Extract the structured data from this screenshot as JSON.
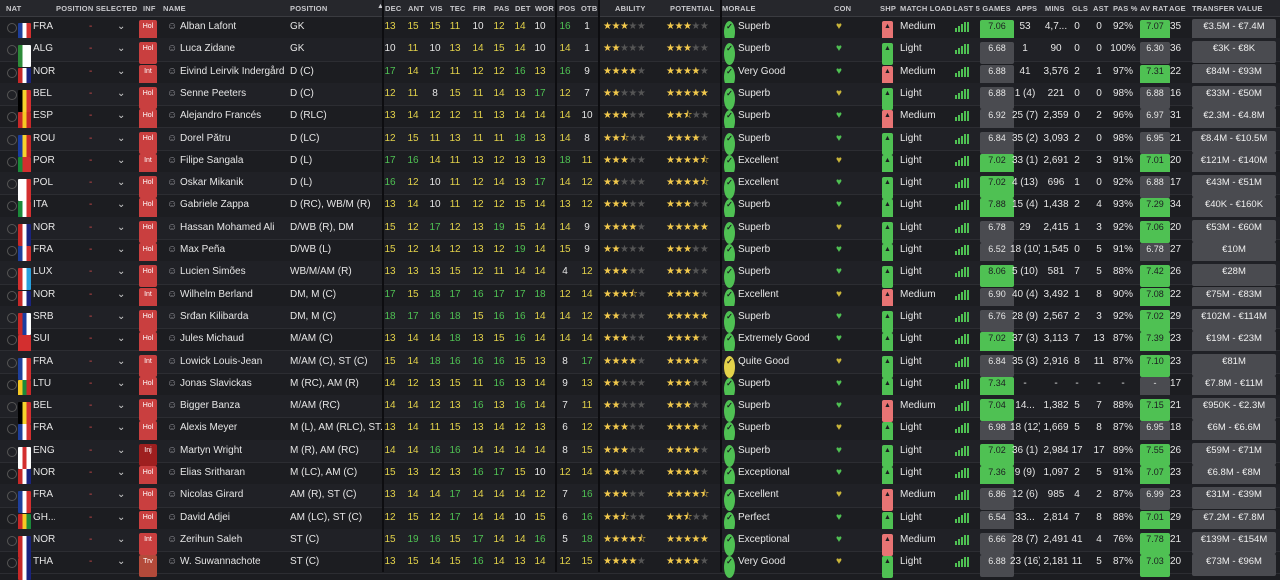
{
  "headers": [
    "NAT",
    "POSITION SELECTED",
    "INF",
    "NAME",
    "POSITION",
    "DEC",
    "ANT",
    "VIS",
    "TEC",
    "FIR",
    "PAS",
    "DET",
    "WOR",
    "POS",
    "OTB",
    "ABILITY",
    "POTENTIAL",
    "MORALE",
    "CON",
    "SHP",
    "MATCH LOAD",
    "LAST 5 GAMES",
    "APPS",
    "MINS",
    "GLS",
    "AST",
    "PAS %",
    "AV RAT",
    "AGE",
    "TRANSFER VALUE"
  ],
  "sort_icon": "sort-desc-icon",
  "colors": {
    "green": "#4fc153",
    "yellow": "#e3d24a",
    "white": "#e6e6e6",
    "star": "#f2c94c"
  },
  "players": [
    {
      "nat": "FRA",
      "inf": "Hol",
      "name": "Alban Lafont",
      "pos": "GK",
      "attrs": [
        "13",
        "15",
        "15",
        "11",
        "10",
        "12",
        "14",
        "10"
      ],
      "posv": "16",
      "otb": "1",
      "ab": 3,
      "pot": 3,
      "morale": "Superb",
      "ml": "Medium",
      "l5": "7.06",
      "apps": "53",
      "mins": "4,7...",
      "gls": "0",
      "ast": "0",
      "pas": "92%",
      "avr": "7.07",
      "age": "35",
      "tv": "€3.5M - €7.4M"
    },
    {
      "nat": "ALG",
      "inf": "Hol",
      "name": "Luca Zidane",
      "pos": "GK",
      "attrs": [
        "10",
        "11",
        "10",
        "13",
        "14",
        "15",
        "14",
        "10"
      ],
      "posv": "14",
      "otb": "1",
      "ab": 2,
      "pot": 3,
      "morale": "Superb",
      "ml": "Light",
      "l5": "6.68",
      "apps": "1",
      "mins": "90",
      "gls": "0",
      "ast": "0",
      "pas": "100%",
      "avr": "6.30",
      "age": "36",
      "tv": "€3K - €8K"
    },
    {
      "nat": "NOR",
      "inf": "Int",
      "name": "Eivind Leirvik Indergård",
      "pos": "D (C)",
      "attrs": [
        "17",
        "14",
        "17",
        "11",
        "12",
        "12",
        "16",
        "13"
      ],
      "posv": "16",
      "otb": "9",
      "ab": 4,
      "pot": 4,
      "morale": "Very Good",
      "ml": "Medium",
      "l5": "6.88",
      "apps": "41",
      "mins": "3,576",
      "gls": "2",
      "ast": "1",
      "pas": "97%",
      "avr": "7.31",
      "age": "22",
      "tv": "€84M - €93M"
    },
    {
      "nat": "BEL",
      "inf": "Hol",
      "name": "Senne Peeters",
      "pos": "D (C)",
      "attrs": [
        "12",
        "11",
        "8",
        "15",
        "11",
        "14",
        "13",
        "17"
      ],
      "posv": "12",
      "otb": "7",
      "ab": 2,
      "pot": 5,
      "morale": "Superb",
      "ml": "Light",
      "l5": "6.88",
      "apps": "1 (4)",
      "mins": "221",
      "gls": "0",
      "ast": "0",
      "pas": "98%",
      "avr": "6.88",
      "age": "16",
      "tv": "€33M - €50M"
    },
    {
      "nat": "ESP",
      "inf": "Hol",
      "name": "Alejandro Francés",
      "pos": "D (RLC)",
      "attrs": [
        "13",
        "14",
        "12",
        "12",
        "11",
        "13",
        "14",
        "14"
      ],
      "posv": "14",
      "otb": "10",
      "ab": 3,
      "pot": 2.5,
      "morale": "Superb",
      "ml": "Medium",
      "l5": "6.92",
      "apps": "25 (7)",
      "mins": "2,359",
      "gls": "0",
      "ast": "2",
      "pas": "96%",
      "avr": "6.97",
      "age": "31",
      "tv": "€2.3M - €4.8M"
    },
    {
      "nat": "ROU",
      "inf": "Hol",
      "name": "Dorel Pătru",
      "pos": "D (LC)",
      "attrs": [
        "12",
        "15",
        "11",
        "13",
        "11",
        "11",
        "18",
        "13"
      ],
      "posv": "14",
      "otb": "8",
      "ab": 2.5,
      "pot": 4,
      "morale": "Superb",
      "ml": "Light",
      "l5": "6.84",
      "apps": "35 (2)",
      "mins": "3,093",
      "gls": "2",
      "ast": "0",
      "pas": "98%",
      "avr": "6.95",
      "age": "21",
      "tv": "€8.4M - €10.5M"
    },
    {
      "nat": "POR",
      "inf": "Int",
      "name": "Filipe Sangala",
      "pos": "D (L)",
      "attrs": [
        "17",
        "16",
        "14",
        "11",
        "13",
        "12",
        "13",
        "13"
      ],
      "posv": "18",
      "otb": "11",
      "ab": 3,
      "pot": 4.5,
      "morale": "Excellent",
      "ml": "Light",
      "l5": "7.02",
      "apps": "33 (1)",
      "mins": "2,691",
      "gls": "2",
      "ast": "3",
      "pas": "91%",
      "avr": "7.01",
      "age": "20",
      "tv": "€121M - €140M"
    },
    {
      "nat": "POL",
      "inf": "Hol",
      "name": "Oskar Mikanik",
      "pos": "D (L)",
      "attrs": [
        "16",
        "12",
        "10",
        "11",
        "12",
        "14",
        "13",
        "17"
      ],
      "posv": "14",
      "otb": "12",
      "ab": 2,
      "pot": 4.5,
      "morale": "Excellent",
      "ml": "Light",
      "l5": "7.02",
      "apps": "4 (13)",
      "mins": "696",
      "gls": "1",
      "ast": "0",
      "pas": "92%",
      "avr": "6.88",
      "age": "17",
      "tv": "€43M - €51M"
    },
    {
      "nat": "ITA",
      "inf": "Hol",
      "name": "Gabriele Zappa",
      "pos": "D (RC), WB/M (R)",
      "attrs": [
        "13",
        "14",
        "10",
        "11",
        "12",
        "12",
        "15",
        "14"
      ],
      "posv": "13",
      "otb": "12",
      "ab": 3,
      "pot": 3,
      "morale": "Superb",
      "ml": "Light",
      "l5": "7.88",
      "apps": "15 (4)",
      "mins": "1,438",
      "gls": "2",
      "ast": "4",
      "pas": "93%",
      "avr": "7.29",
      "age": "34",
      "tv": "€40K - €160K"
    },
    {
      "nat": "NOR",
      "inf": "Hol",
      "name": "Hassan Mohamed Ali",
      "pos": "D/WB (R), DM",
      "attrs": [
        "15",
        "12",
        "17",
        "12",
        "13",
        "19",
        "15",
        "14"
      ],
      "posv": "14",
      "otb": "9",
      "ab": 4,
      "pot": 5,
      "morale": "Superb",
      "ml": "Light",
      "l5": "6.78",
      "apps": "29",
      "mins": "2,415",
      "gls": "1",
      "ast": "3",
      "pas": "92%",
      "avr": "7.06",
      "age": "20",
      "tv": "€53M - €60M"
    },
    {
      "nat": "FRA",
      "inf": "Hol",
      "name": "Max Peña",
      "pos": "D/WB (L)",
      "attrs": [
        "15",
        "12",
        "14",
        "12",
        "13",
        "12",
        "19",
        "14"
      ],
      "posv": "15",
      "otb": "9",
      "ab": 2,
      "pot": 3,
      "morale": "Superb",
      "ml": "Light",
      "l5": "6.52",
      "apps": "18 (10)",
      "mins": "1,545",
      "gls": "0",
      "ast": "5",
      "pas": "91%",
      "avr": "6.78",
      "age": "27",
      "tv": "€10M"
    },
    {
      "nat": "LUX",
      "inf": "Hol",
      "name": "Lucien Simões",
      "pos": "WB/M/AM (R)",
      "attrs": [
        "13",
        "13",
        "13",
        "15",
        "12",
        "11",
        "14",
        "14"
      ],
      "posv": "4",
      "otb": "12",
      "ab": 3,
      "pot": 3,
      "morale": "Superb",
      "ml": "Light",
      "l5": "8.06",
      "apps": "5 (10)",
      "mins": "581",
      "gls": "7",
      "ast": "5",
      "pas": "88%",
      "avr": "7.42",
      "age": "26",
      "tv": "€28M"
    },
    {
      "nat": "NOR",
      "inf": "Int",
      "name": "Wilhelm Berland",
      "pos": "DM, M (C)",
      "attrs": [
        "17",
        "15",
        "18",
        "17",
        "16",
        "17",
        "17",
        "18"
      ],
      "posv": "12",
      "otb": "14",
      "ab": 3.5,
      "pot": 4,
      "morale": "Excellent",
      "ml": "Medium",
      "l5": "6.90",
      "apps": "40 (4)",
      "mins": "3,492",
      "gls": "1",
      "ast": "8",
      "pas": "90%",
      "avr": "7.08",
      "age": "22",
      "tv": "€75M - €83M"
    },
    {
      "nat": "SRB",
      "inf": "Hol",
      "name": "Srđan Kilibarda",
      "pos": "DM, M (C)",
      "attrs": [
        "18",
        "17",
        "16",
        "18",
        "15",
        "16",
        "16",
        "14"
      ],
      "posv": "14",
      "otb": "12",
      "ab": 2,
      "pot": 5,
      "morale": "Superb",
      "ml": "Light",
      "l5": "6.76",
      "apps": "28 (9)",
      "mins": "2,567",
      "gls": "2",
      "ast": "3",
      "pas": "92%",
      "avr": "7.02",
      "age": "29",
      "tv": "€102M - €114M"
    },
    {
      "nat": "SUI",
      "inf": "Hol",
      "name": "Jules Michaud",
      "pos": "M/AM (C)",
      "attrs": [
        "13",
        "14",
        "14",
        "18",
        "13",
        "15",
        "16",
        "14"
      ],
      "posv": "14",
      "otb": "14",
      "ab": 3,
      "pot": 4,
      "morale": "Extremely Good",
      "ml": "Light",
      "l5": "7.02",
      "apps": "37 (3)",
      "mins": "3,113",
      "gls": "7",
      "ast": "13",
      "pas": "87%",
      "avr": "7.39",
      "age": "23",
      "tv": "€19M - €23M"
    },
    {
      "nat": "FRA",
      "inf": "Int",
      "name": "Lowick Louis-Jean",
      "pos": "M/AM (C), ST (C)",
      "attrs": [
        "15",
        "14",
        "18",
        "16",
        "16",
        "16",
        "15",
        "13"
      ],
      "posv": "8",
      "otb": "17",
      "ab": 4,
      "pot": 4,
      "morale": "Quite Good",
      "ml": "Light",
      "l5": "6.84",
      "apps": "35 (3)",
      "mins": "2,916",
      "gls": "8",
      "ast": "11",
      "pas": "87%",
      "avr": "7.10",
      "age": "23",
      "tv": "€81M"
    },
    {
      "nat": "LTU",
      "inf": "Hol",
      "name": "Jonas Slavickas",
      "pos": "M (RC), AM (R)",
      "attrs": [
        "14",
        "12",
        "13",
        "15",
        "11",
        "16",
        "13",
        "14"
      ],
      "posv": "9",
      "otb": "13",
      "ab": 2,
      "pot": 3,
      "morale": "Superb",
      "ml": "Light",
      "l5": "7.34",
      "apps": "-",
      "mins": "-",
      "gls": "-",
      "ast": "-",
      "pas": "-",
      "avr": "-",
      "age": "17",
      "tv": "€7.8M - €11M"
    },
    {
      "nat": "BEL",
      "inf": "Hol",
      "name": "Bigger Banza",
      "pos": "M/AM (RC)",
      "attrs": [
        "14",
        "14",
        "12",
        "13",
        "16",
        "13",
        "16",
        "14"
      ],
      "posv": "7",
      "otb": "11",
      "ab": 2,
      "pot": 3,
      "morale": "Superb",
      "ml": "Medium",
      "l5": "7.04",
      "apps": "14...",
      "mins": "1,382",
      "gls": "5",
      "ast": "7",
      "pas": "88%",
      "avr": "7.15",
      "age": "21",
      "tv": "€950K - €2.3M"
    },
    {
      "nat": "FRA",
      "inf": "Hol",
      "name": "Alexis Meyer",
      "pos": "M (L), AM (RLC), ST...",
      "attrs": [
        "13",
        "14",
        "11",
        "15",
        "13",
        "14",
        "12",
        "13"
      ],
      "posv": "6",
      "otb": "12",
      "ab": 3,
      "pot": 4,
      "morale": "Superb",
      "ml": "Light",
      "l5": "6.98",
      "apps": "18 (12)",
      "mins": "1,669",
      "gls": "5",
      "ast": "8",
      "pas": "87%",
      "avr": "6.95",
      "age": "18",
      "tv": "€6M - €6.6M"
    },
    {
      "nat": "ENG",
      "inf": "Inj",
      "name": "Martyn Wright",
      "pos": "M (R), AM (RC)",
      "attrs": [
        "14",
        "14",
        "16",
        "16",
        "14",
        "14",
        "14",
        "14"
      ],
      "posv": "8",
      "otb": "15",
      "ab": 3,
      "pot": 4,
      "morale": "Superb",
      "ml": "Light",
      "l5": "7.02",
      "apps": "36 (1)",
      "mins": "2,984",
      "gls": "17",
      "ast": "17",
      "pas": "89%",
      "avr": "7.55",
      "age": "26",
      "tv": "€59M - €71M"
    },
    {
      "nat": "NOR",
      "inf": "Hol",
      "name": "Elias Sritharan",
      "pos": "M (LC), AM (C)",
      "attrs": [
        "15",
        "13",
        "12",
        "13",
        "16",
        "17",
        "15",
        "10"
      ],
      "posv": "12",
      "otb": "14",
      "ab": 2,
      "pot": 4,
      "morale": "Exceptional",
      "ml": "Light",
      "l5": "7.36",
      "apps": "9 (9)",
      "mins": "1,097",
      "gls": "2",
      "ast": "5",
      "pas": "91%",
      "avr": "7.07",
      "age": "23",
      "tv": "€6.8M - €8M"
    },
    {
      "nat": "FRA",
      "inf": "Hol",
      "name": "Nicolas Girard",
      "pos": "AM (R), ST (C)",
      "attrs": [
        "13",
        "14",
        "14",
        "17",
        "14",
        "14",
        "14",
        "12"
      ],
      "posv": "7",
      "otb": "16",
      "ab": 3,
      "pot": 4.5,
      "morale": "Excellent",
      "ml": "Medium",
      "l5": "6.86",
      "apps": "12 (6)",
      "mins": "985",
      "gls": "4",
      "ast": "2",
      "pas": "87%",
      "avr": "6.99",
      "age": "23",
      "tv": "€31M - €39M"
    },
    {
      "nat": "GH...",
      "inf": "Hol",
      "name": "David Adjei",
      "pos": "AM (LC), ST (C)",
      "attrs": [
        "12",
        "15",
        "12",
        "17",
        "14",
        "14",
        "10",
        "15"
      ],
      "posv": "6",
      "otb": "16",
      "ab": 2.5,
      "pot": 2.5,
      "morale": "Perfect",
      "ml": "Light",
      "l5": "6.54",
      "apps": "33...",
      "mins": "2,814",
      "gls": "7",
      "ast": "8",
      "pas": "88%",
      "avr": "7.01",
      "age": "29",
      "tv": "€7.2M - €7.8M"
    },
    {
      "nat": "NOR",
      "inf": "Int",
      "name": "Zerihun Saleh",
      "pos": "ST (C)",
      "attrs": [
        "15",
        "19",
        "16",
        "15",
        "17",
        "14",
        "14",
        "16"
      ],
      "posv": "5",
      "otb": "18",
      "ab": 4.5,
      "pot": 5,
      "morale": "Exceptional",
      "ml": "Medium",
      "l5": "6.66",
      "apps": "28 (7)",
      "mins": "2,491",
      "gls": "41",
      "ast": "4",
      "pas": "76%",
      "avr": "7.78",
      "age": "21",
      "tv": "€139M - €154M"
    },
    {
      "nat": "THA",
      "inf": "Trv",
      "name": "W. Suwannachote",
      "pos": "ST (C)",
      "attrs": [
        "13",
        "15",
        "14",
        "15",
        "16",
        "14",
        "13",
        "14"
      ],
      "posv": "12",
      "otb": "15",
      "ab": 4,
      "pot": 4,
      "morale": "Very Good",
      "ml": "Light",
      "l5": "6.88",
      "apps": "23 (16)",
      "mins": "2,181",
      "gls": "11",
      "ast": "5",
      "pas": "87%",
      "avr": "7.03",
      "age": "20",
      "tv": "€73M - €96M"
    }
  ]
}
